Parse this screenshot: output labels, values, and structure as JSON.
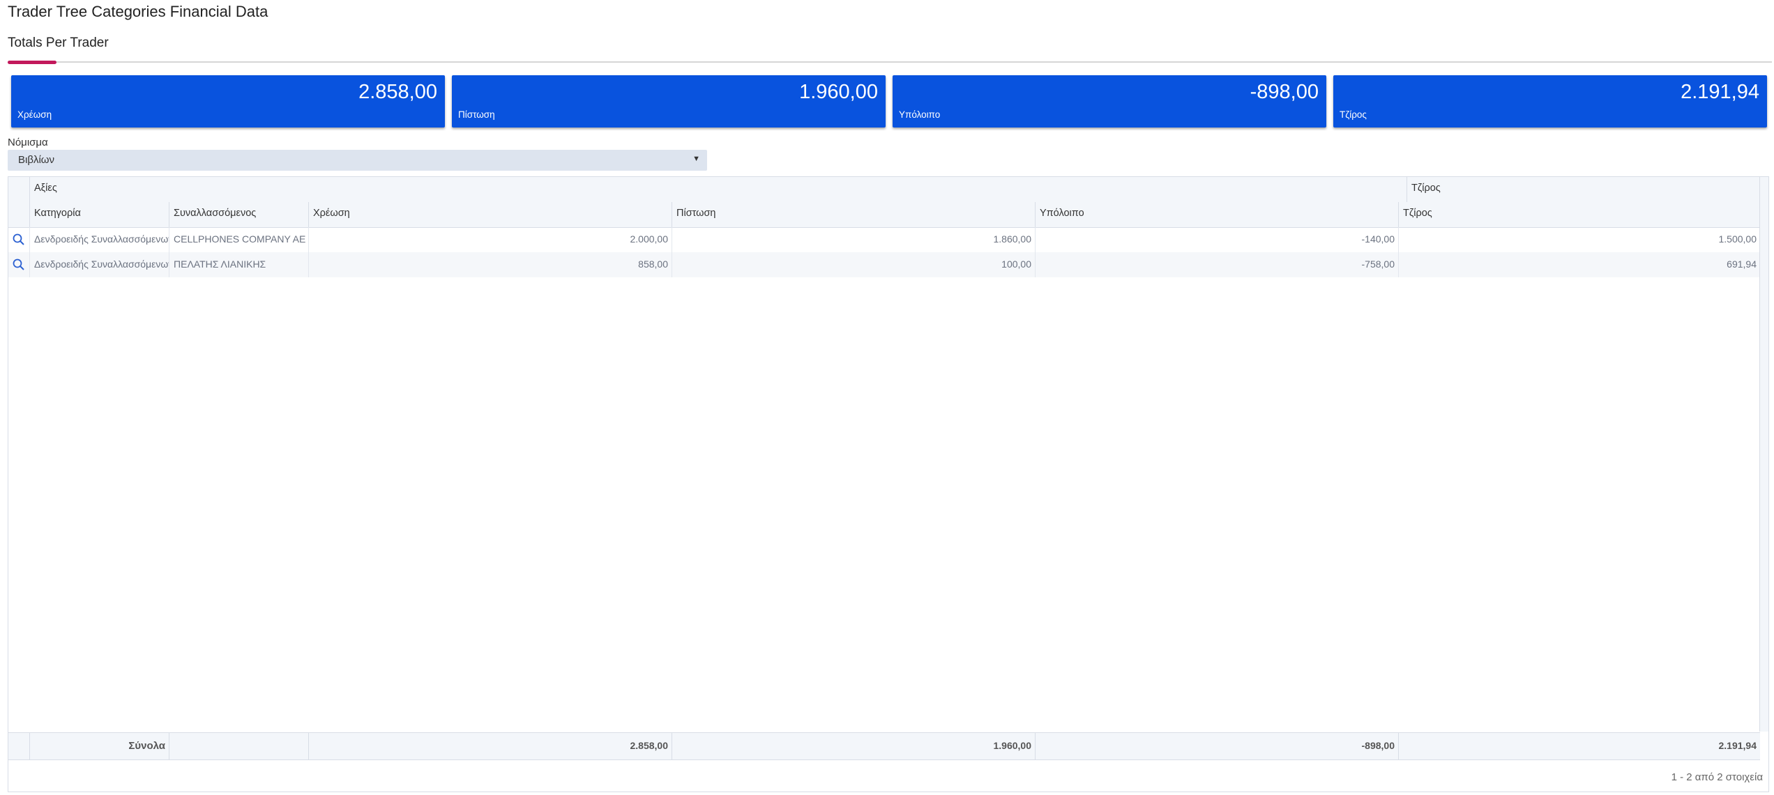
{
  "page": {
    "title": "Trader Tree Categories Financial Data"
  },
  "tabs": [
    {
      "label": "Totals Per Trader",
      "active": true
    }
  ],
  "colors": {
    "card_bg": "#0953de",
    "tab_accent": "#c2185b",
    "header_bg": "#f3f6fa",
    "select_bg": "#dde4ef"
  },
  "cards": [
    {
      "value": "2.858,00",
      "label": "Χρέωση"
    },
    {
      "value": "1.960,00",
      "label": "Πίστωση"
    },
    {
      "value": "-898,00",
      "label": "Υπόλοιπο"
    },
    {
      "value": "2.191,94",
      "label": "Τζίρος"
    }
  ],
  "currency": {
    "label": "Νόμισμα",
    "selected": "Βιβλίων"
  },
  "grid": {
    "group_headers": {
      "values": "Αξίες",
      "turnover": "Τζίρος"
    },
    "columns": [
      "Κατηγορία",
      "Συναλλασσόμενος",
      "Χρέωση",
      "Πίστωση",
      "Υπόλοιπο",
      "Τζίρος"
    ],
    "rows": [
      {
        "category": "Δενδροειδής Συναλλασσόμενων",
        "trader": "CELLPHONES COMPANY AE",
        "debit": "2.000,00",
        "credit": "1.860,00",
        "balance": "-140,00",
        "turnover": "1.500,00"
      },
      {
        "category": "Δενδροειδής Συναλλασσόμενων",
        "trader": "ΠΕΛΑΤΗΣ ΛΙΑΝΙΚΗΣ",
        "debit": "858,00",
        "credit": "100,00",
        "balance": "-758,00",
        "turnover": "691,94"
      }
    ],
    "totals": {
      "label": "Σύνολα",
      "debit": "2.858,00",
      "credit": "1.960,00",
      "balance": "-898,00",
      "turnover": "2.191,94"
    },
    "pager": "1 - 2 από 2 στοιχεία"
  }
}
